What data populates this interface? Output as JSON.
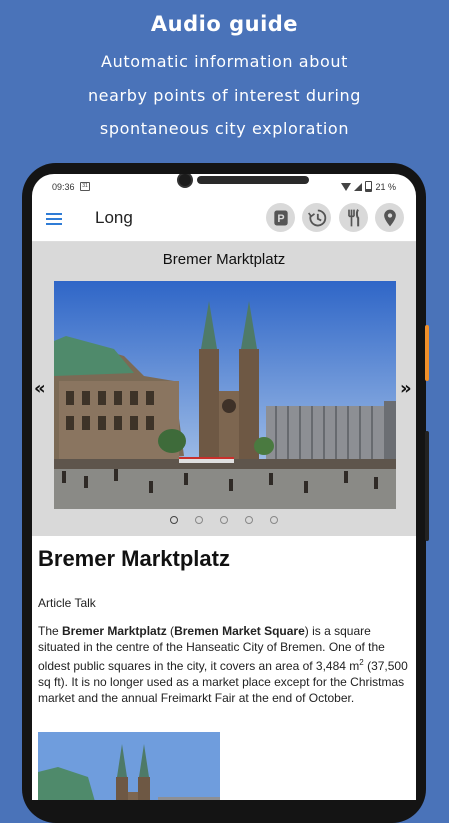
{
  "promo": {
    "title": "Audio guide",
    "line1": "Automatic information about",
    "line2": "nearby points of interest during",
    "line3": "spontaneous city exploration"
  },
  "status": {
    "time": "09:36",
    "battery": "21 %"
  },
  "appbar": {
    "title": "Long",
    "buttons": [
      "parking-icon",
      "history-icon",
      "restaurant-icon",
      "location-pin-icon"
    ]
  },
  "gallery": {
    "title": "Bremer Marktplatz",
    "prev": "«",
    "next": "»",
    "dots": 5,
    "active_dot": 0
  },
  "article": {
    "title": "Bremer Marktplatz",
    "tabs": "Article Talk",
    "body": {
      "p1": "The ",
      "bold1": "Bremer Marktplatz",
      "p2": " (",
      "bold2": "Bremen Market Square",
      "p3": ") is a square situated in the centre of the Hanseatic City of Bremen. One of the oldest public squares in the city, it covers an area of 3,484 m",
      "sup": "2",
      "p4": " (37,500 sq ft). It is no longer used as a market place except for the Christmas market and the annual Freimarkt Fair at the end of October."
    }
  },
  "colors": {
    "background": "#4a73b9",
    "accent": "#2f7cd6",
    "gallery_bg": "#d9d9d9"
  }
}
